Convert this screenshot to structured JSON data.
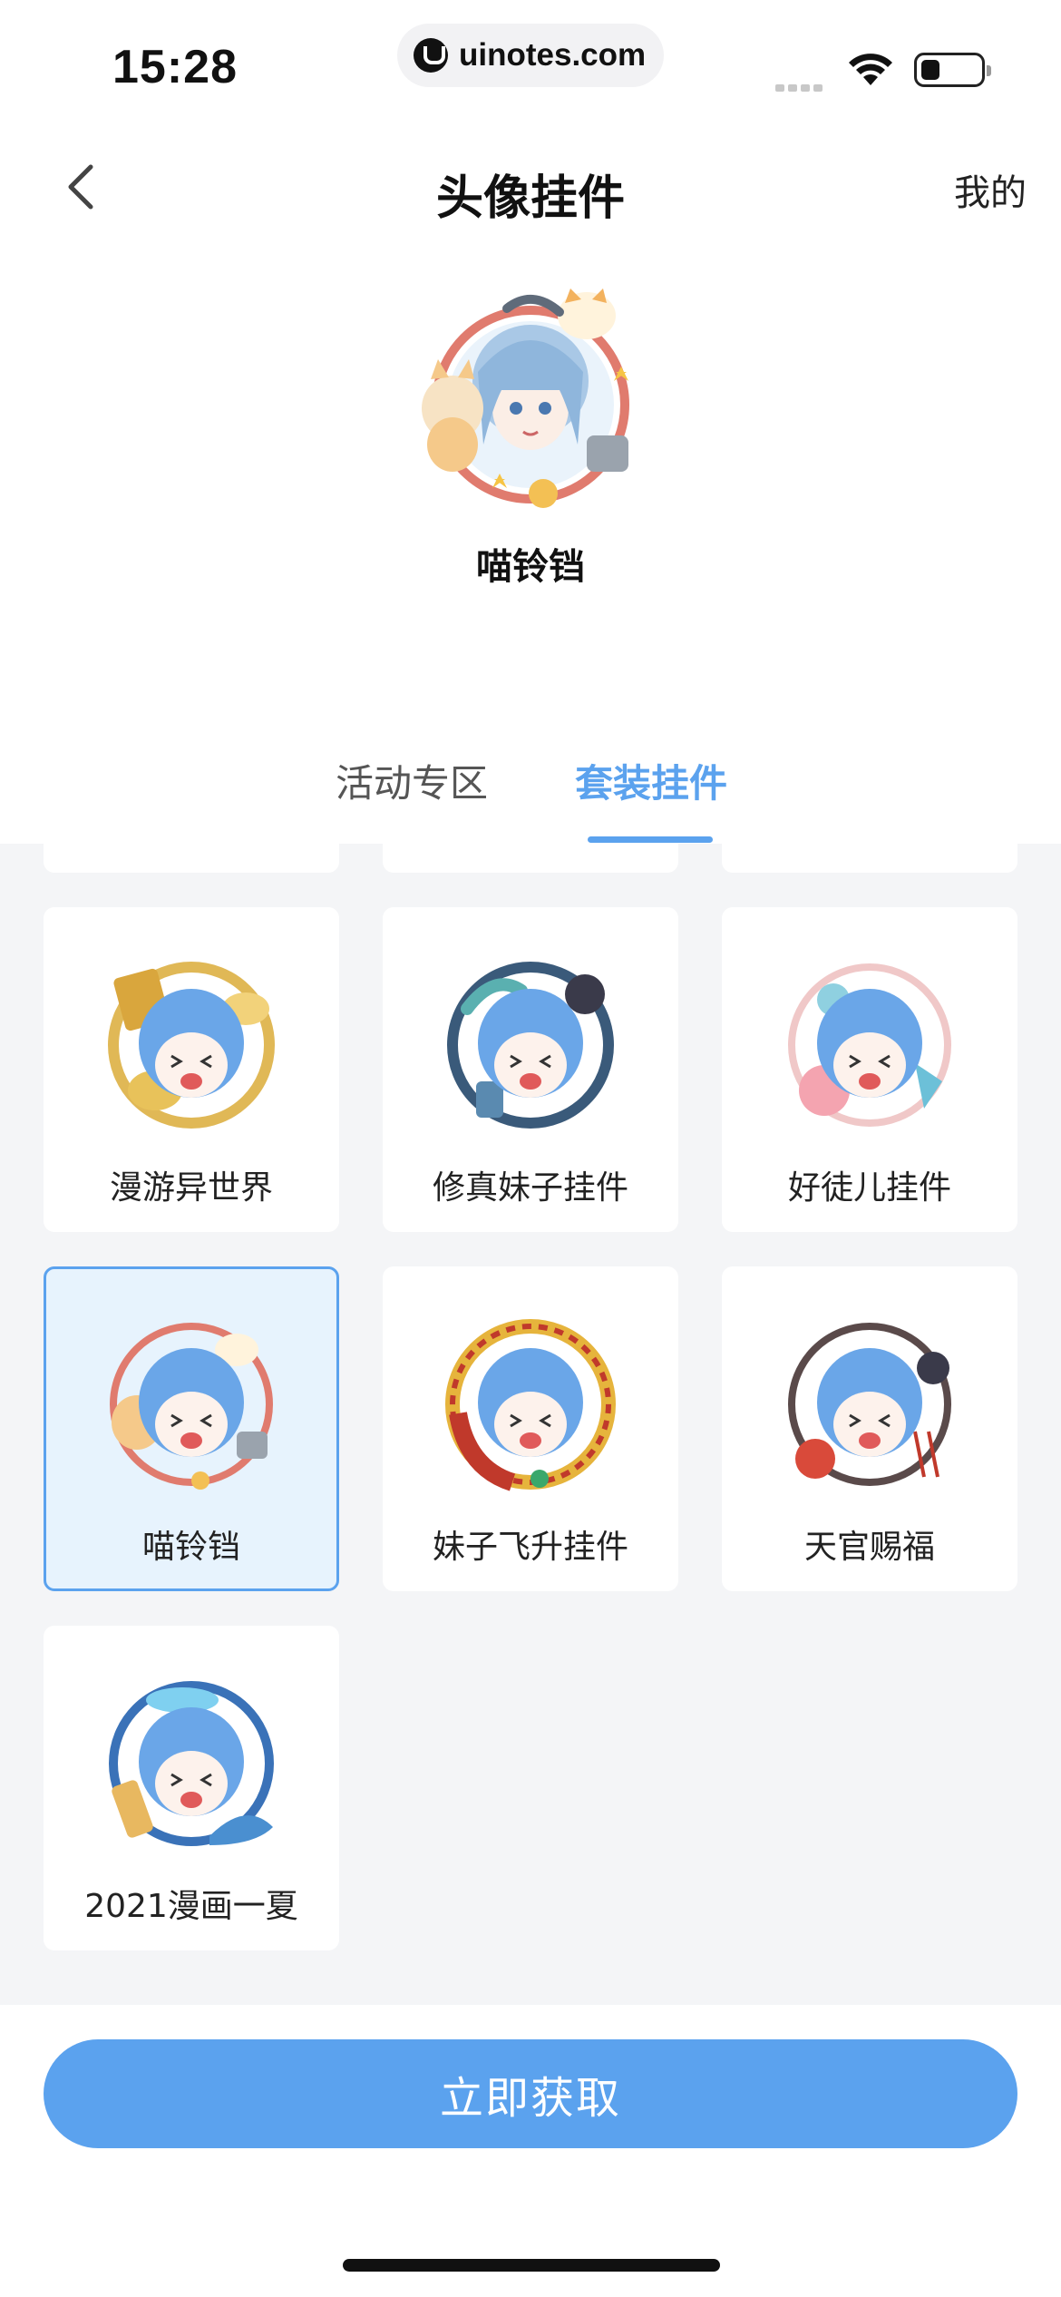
{
  "status_bar": {
    "time": "15:28",
    "url": "uinotes.com"
  },
  "nav": {
    "title": "头像挂件",
    "right_label": "我的"
  },
  "preview": {
    "name": "喵铃铛"
  },
  "tabs": [
    {
      "label": "活动专区",
      "active": false
    },
    {
      "label": "套装挂件",
      "active": true
    }
  ],
  "items": [
    {
      "label": "漫游异世界",
      "selected": false
    },
    {
      "label": "修真妹子挂件",
      "selected": false
    },
    {
      "label": "好徒儿挂件",
      "selected": false
    },
    {
      "label": "喵铃铛",
      "selected": true
    },
    {
      "label": "妹子飞升挂件",
      "selected": false
    },
    {
      "label": "天官赐福",
      "selected": false
    },
    {
      "label": "2021漫画一夏",
      "selected": false
    }
  ],
  "cta": {
    "label": "立即获取"
  },
  "colors": {
    "accent": "#5ba2ee",
    "grid_bg": "#f4f5f7",
    "selected_bg": "#e7f3fd"
  }
}
